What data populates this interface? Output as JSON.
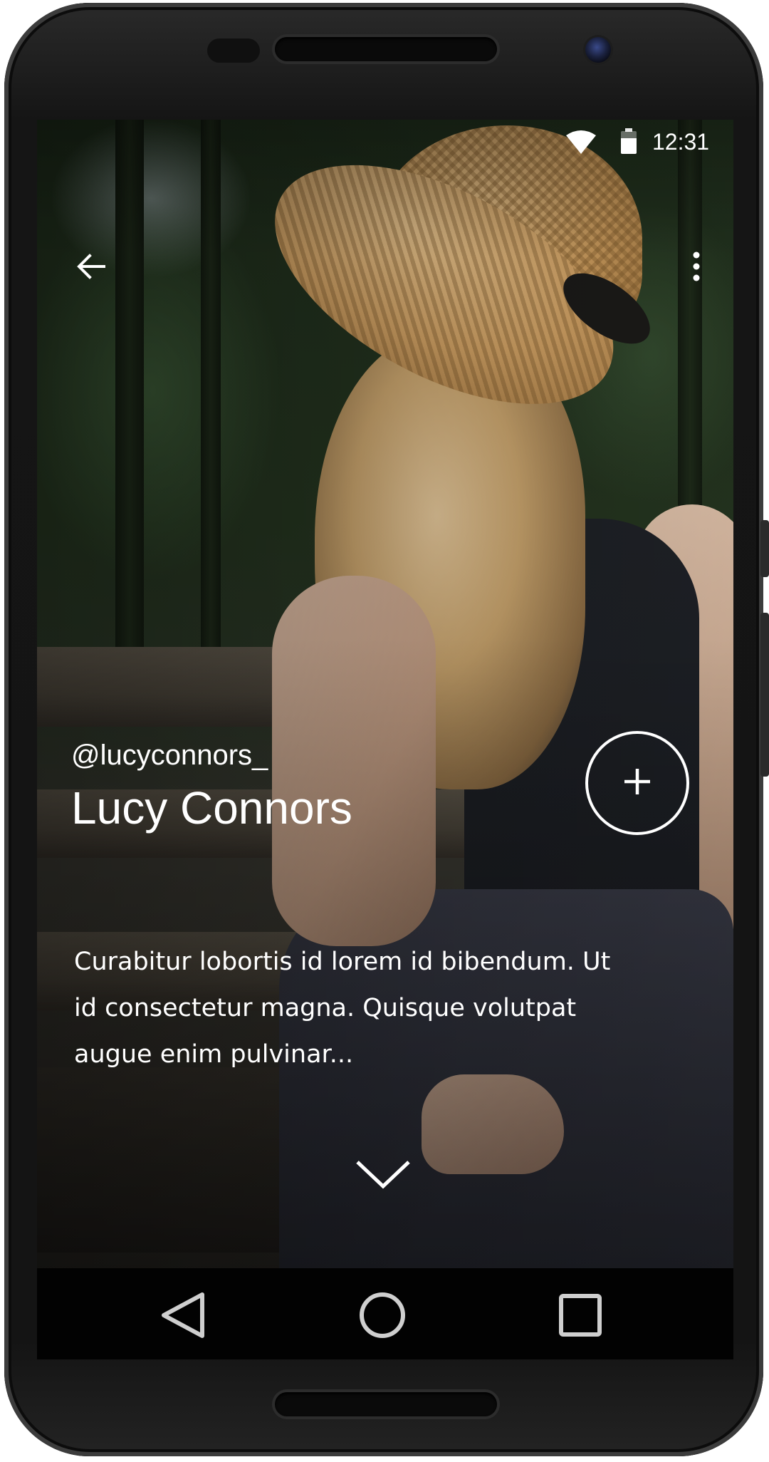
{
  "status_bar": {
    "time": "12:31",
    "wifi_icon": "wifi-icon",
    "battery_icon": "battery-icon",
    "battery_level": 0.7
  },
  "app_bar": {
    "back_icon": "arrow-back-icon",
    "overflow_icon": "more-vert-icon"
  },
  "profile": {
    "handle": "@lucyconnors_",
    "name": "Lucy Connors",
    "follow_icon": "plus-icon",
    "bio_lines": [
      "Curabitur lobortis id lorem id bibendum. Ut",
      "id consectetur magna. Quisque volutpat",
      "augue enim pulvinar..."
    ],
    "expand_icon": "chevron-down-icon"
  },
  "nav_bar": {
    "back_icon": "nav-back-triangle-icon",
    "home_icon": "nav-home-circle-icon",
    "recents_icon": "nav-recents-square-icon"
  },
  "colors": {
    "text": "#ffffff",
    "nav_background": "#020202",
    "phone_frame": "#141414"
  }
}
